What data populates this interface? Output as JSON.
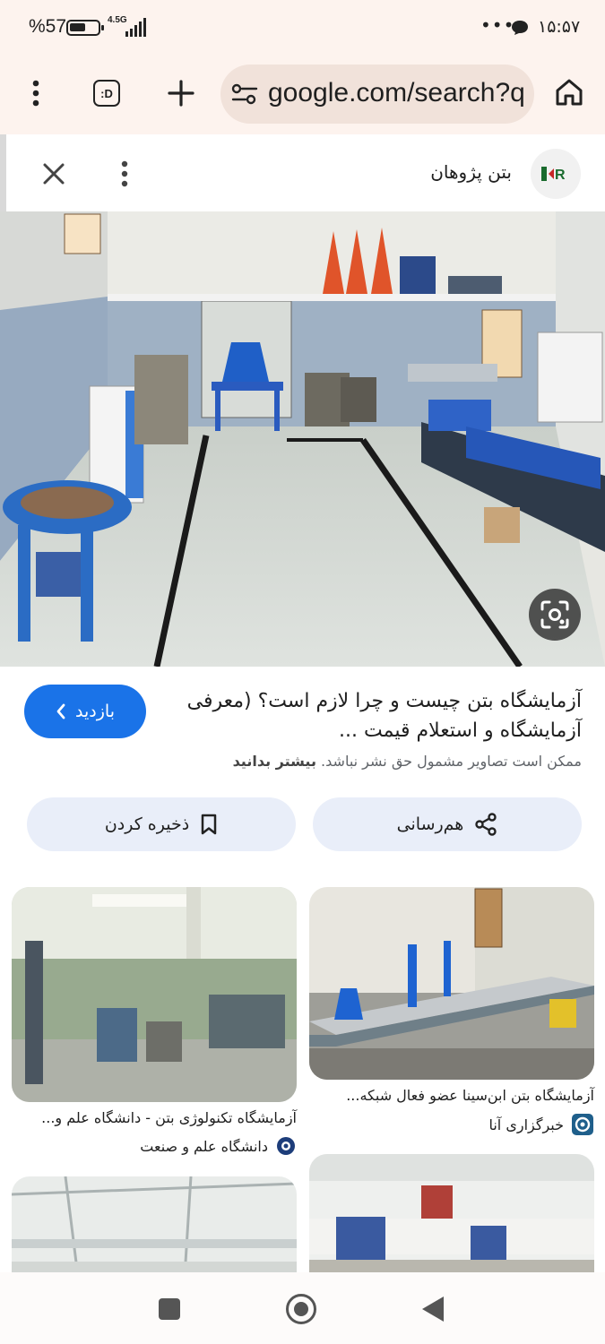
{
  "status_bar": {
    "battery": "%57",
    "battery_level": 0.57,
    "network": "4.5G",
    "dots": "•••",
    "time": "۱۵:۵۷"
  },
  "toolbar": {
    "tabs_label": ":D",
    "url": "google.com/search?q",
    "icons": [
      "more-vert-icon",
      "tab-switcher-icon",
      "new-tab-plus-icon",
      "site-settings-icon",
      "home-icon"
    ]
  },
  "result": {
    "source_name": "بتن پژوهان",
    "title": "آزمایشگاه بتن چیست و چرا لازم است؟ (معرفی آزمایشگاه و استعلام قیمت ...",
    "visit_label": "بازدید",
    "copyright_text": "ممکن است تصاویر مشمول حق نشر نباشد.",
    "learn_more": "بیشتر بدانید",
    "share_label": "هم‌رسانی",
    "save_label": "ذخیره کردن"
  },
  "related": [
    {
      "title": "آزمایشگاه بتن ابن‌سینا عضو فعال شبکه...",
      "source": "خبرگزاری آنا"
    },
    {
      "title": "آزمایشگاه تکنولوژی بتن - دانشگاه علم و...",
      "source": "دانشگاه علم و صنعت"
    }
  ],
  "colors": {
    "accent": "#1a73e8",
    "chrome_bg": "#fdf3ee",
    "pill_bg": "#e9eef9"
  }
}
